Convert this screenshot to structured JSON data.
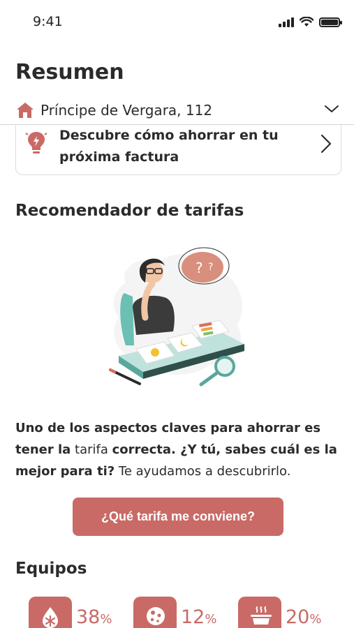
{
  "status_bar": {
    "time": "9:41"
  },
  "header": {
    "title": "Resumen",
    "address": "Príncipe de Vergara, 112"
  },
  "tip_card": {
    "line1": "Descubre cómo ahorrar en tu",
    "line2": "próxima factura"
  },
  "recommender": {
    "title": "Recomendador de tarifas",
    "desc_bold_1": "Uno de los aspectos claves para ahorrar es tener la",
    "desc_regular_1": "tarifa",
    "desc_bold_2": "correcta. ¿Y tú, sabes cuál es la mejor para ti?",
    "desc_regular_2": "Te ayudamos a descubrirlo.",
    "button_label": "¿Qué tarifa me conviene?"
  },
  "equipos": {
    "title": "Equipos",
    "items": [
      {
        "icon": "water-heater-icon",
        "value": "38",
        "unit": "%"
      },
      {
        "icon": "cooktop-icon",
        "value": "12",
        "unit": "%"
      },
      {
        "icon": "cooking-pot-icon",
        "value": "20",
        "unit": "%"
      }
    ]
  },
  "colors": {
    "accent": "#c96a66",
    "text": "#2b2b2b"
  }
}
